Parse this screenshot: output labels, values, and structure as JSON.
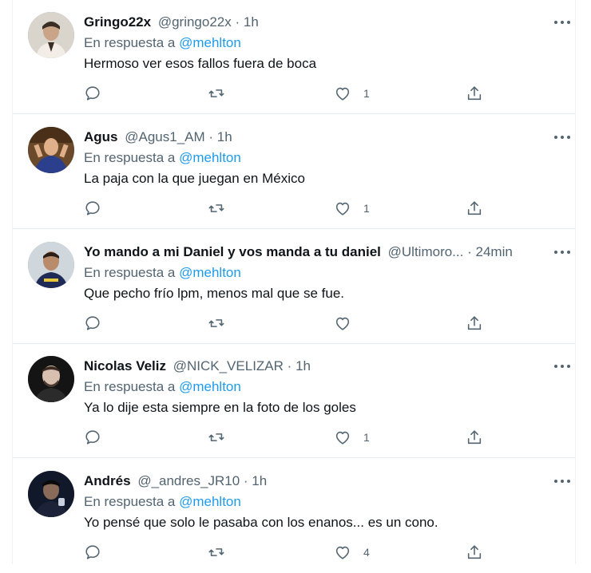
{
  "reply_prefix": "En respuesta a",
  "tweets": [
    {
      "display_name": "Gringo22x",
      "handle": "@gringo22x",
      "separator": "·",
      "time": "1h",
      "reply_to": "@mehlton",
      "text": "Hermoso ver esos fallos fuera de boca",
      "like_count": "1",
      "avatar_colors": [
        "#d9d4cc",
        "#3a2d24",
        "#f2ede6"
      ]
    },
    {
      "display_name": "Agus",
      "handle": "@Agus1_AM",
      "separator": "·",
      "time": "1h",
      "reply_to": "@mehlton",
      "text": "La paja con la que juegan en México",
      "like_count": "1",
      "avatar_colors": [
        "#6a4a2a",
        "#2b3f8c",
        "#e0b08a"
      ]
    },
    {
      "display_name": "Yo mando a mi Daniel y vos manda a tu daniel",
      "handle": "@Ultimoro...",
      "separator": "·",
      "time": "24min",
      "reply_to": "@mehlton",
      "text": "Que pecho frío lpm, menos mal que se fue.",
      "like_count": "",
      "avatar_colors": [
        "#cfd6dc",
        "#1f2a56",
        "#b88b6a"
      ]
    },
    {
      "display_name": "Nicolas Veliz",
      "handle": "@NICK_VELIZAR",
      "separator": "·",
      "time": "1h",
      "reply_to": "@mehlton",
      "text": "Ya lo dije esta siempre en la foto de los goles",
      "like_count": "1",
      "avatar_colors": [
        "#141414",
        "#2b2b2b",
        "#d8c0b0"
      ]
    },
    {
      "display_name": "Andrés",
      "handle": "@_andres_JR10",
      "separator": "·",
      "time": "1h",
      "reply_to": "@mehlton",
      "text": "Yo pensé que solo le pasaba con los enanos... es un cono.",
      "like_count": "4",
      "avatar_colors": [
        "#10182a",
        "#1c2238",
        "#8a6a58"
      ]
    }
  ],
  "icons": {
    "reply": "reply-icon",
    "retweet": "retweet-icon",
    "like": "heart-icon",
    "share": "share-icon",
    "more": "more-options-icon"
  },
  "colors": {
    "text_primary": "#0f1419",
    "text_secondary": "#536471",
    "link": "#1d9bf0",
    "divider": "#e6ecf0"
  }
}
